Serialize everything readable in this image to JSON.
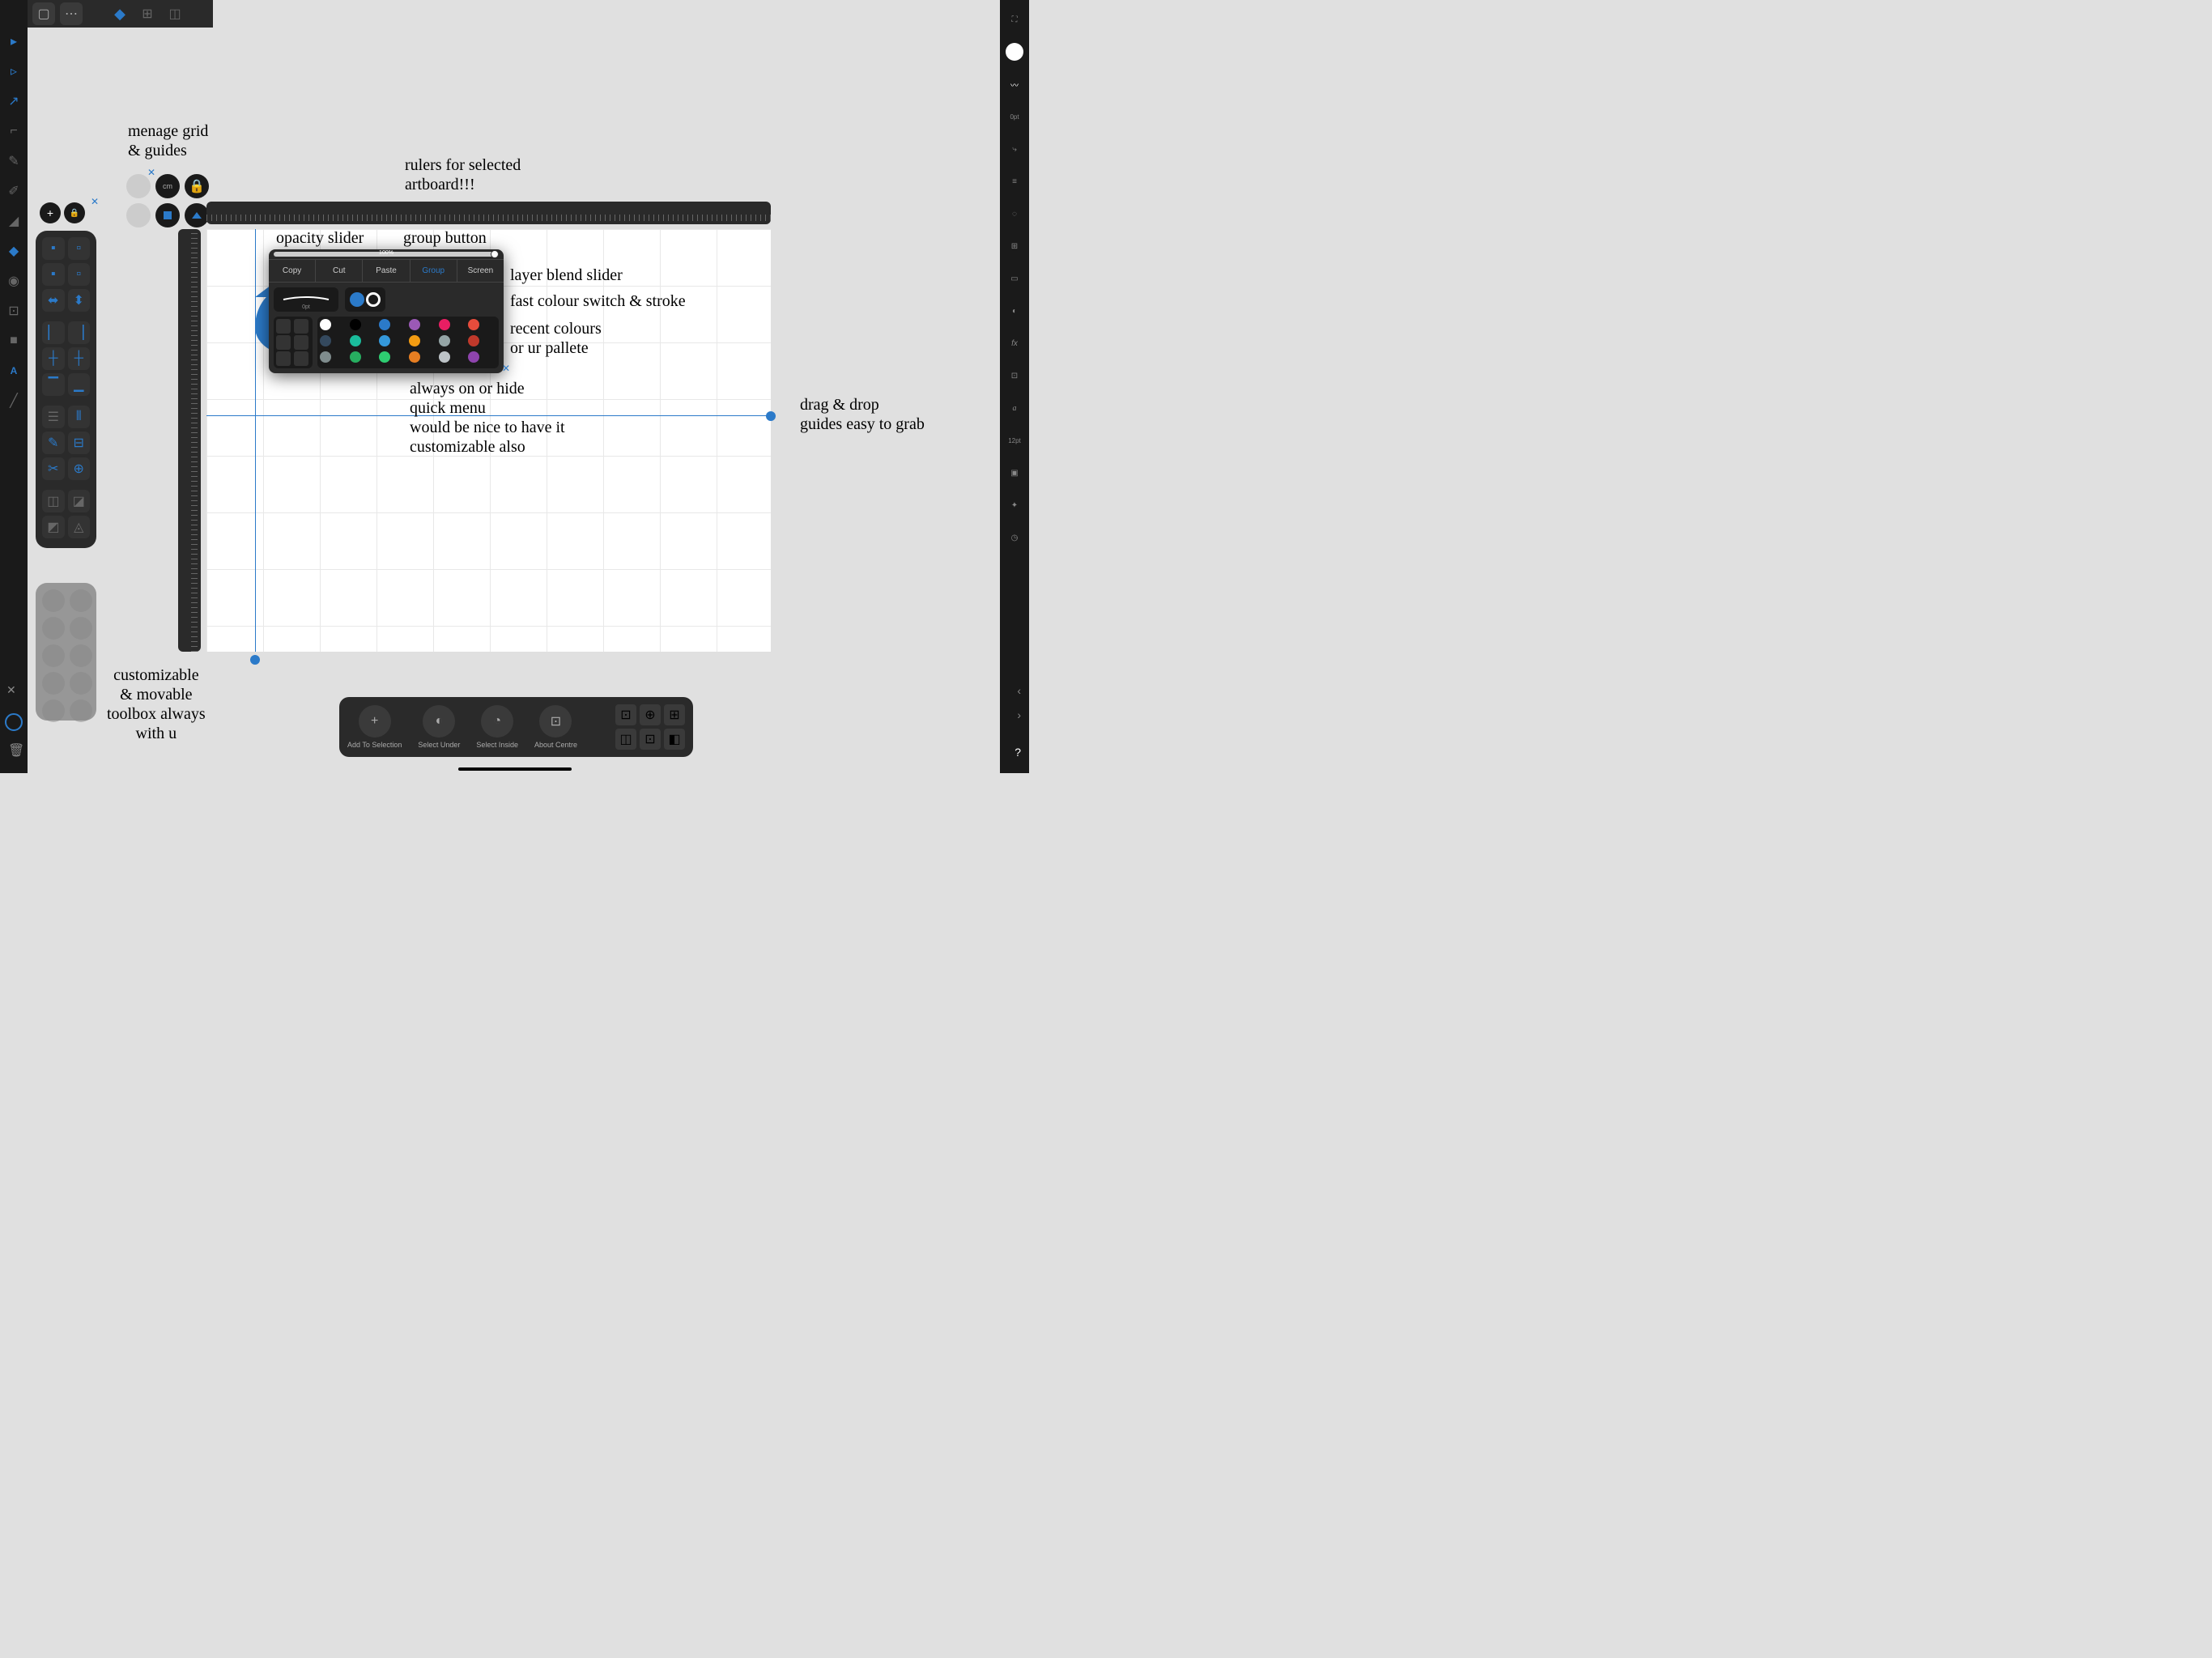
{
  "top": {
    "back": "←"
  },
  "annotations": {
    "grid": "menage grid\n& guides",
    "rulers": "rulers for selected\nartboard!!!",
    "opacity": "opacity slider",
    "group": "group button",
    "blend": "layer blend slider",
    "colour": "fast colour switch & stroke",
    "recent": "recent colours\nor ur pallete",
    "hide": "always on or hide\nquick menu\nwould be nice to have it\ncustomizable also",
    "drag": "drag & drop\nguides easy to grab",
    "toolbox": "customizable\n& movable\ntoolbox always\nwith u"
  },
  "quickmenu": {
    "opacity_label": "100%",
    "buttons": [
      "Copy",
      "Cut",
      "Paste",
      "Group",
      "Screen"
    ],
    "active_index": 3,
    "brush_label": "0pt"
  },
  "grid_panel": {
    "unit": "cm"
  },
  "palette": [
    "#fff",
    "#000",
    "#2b7ac9",
    "#9b59b6",
    "#e91e63",
    "#e74c3c",
    "#34495e",
    "#1abc9c",
    "#3498db",
    "#f39c12",
    "#95a5a6",
    "#c0392b",
    "#7f8c8d",
    "#27ae60",
    "#2ecc71",
    "#e67e22",
    "#bdc3c7",
    "#8e44ad"
  ],
  "bottom": {
    "items": [
      {
        "label": "Add To Selection",
        "icon": "+"
      },
      {
        "label": "Select Under",
        "icon": "◐"
      },
      {
        "label": "Select Inside",
        "icon": "◔"
      },
      {
        "label": "About Centre",
        "icon": "⊡"
      }
    ]
  },
  "right": {
    "stroke_size": "0pt",
    "font_size": "12pt",
    "help": "?"
  },
  "colors": {
    "accent": "#2b7ac9"
  }
}
